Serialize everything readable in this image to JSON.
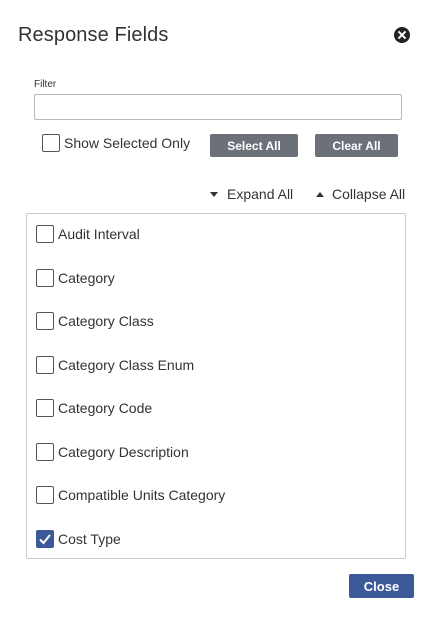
{
  "dialog": {
    "title": "Response Fields",
    "close_icon": "close-circle-icon"
  },
  "filter": {
    "label": "Filter",
    "value": "",
    "placeholder": ""
  },
  "options": {
    "show_selected_label": "Show Selected Only",
    "show_selected_checked": false,
    "select_all_label": "Select All",
    "clear_all_label": "Clear All",
    "expand_all_label": "Expand All",
    "collapse_all_label": "Collapse All"
  },
  "fields": [
    {
      "label": "Audit Interval",
      "checked": false
    },
    {
      "label": "Category",
      "checked": false
    },
    {
      "label": "Category Class",
      "checked": false
    },
    {
      "label": "Category Class Enum",
      "checked": false
    },
    {
      "label": "Category Code",
      "checked": false
    },
    {
      "label": "Category Description",
      "checked": false
    },
    {
      "label": "Compatible Units Category",
      "checked": false
    },
    {
      "label": "Cost Type",
      "checked": true
    }
  ],
  "footer": {
    "close_label": "Close"
  },
  "colors": {
    "primary": "#3c5a99",
    "secondary_button": "#6b7079"
  }
}
